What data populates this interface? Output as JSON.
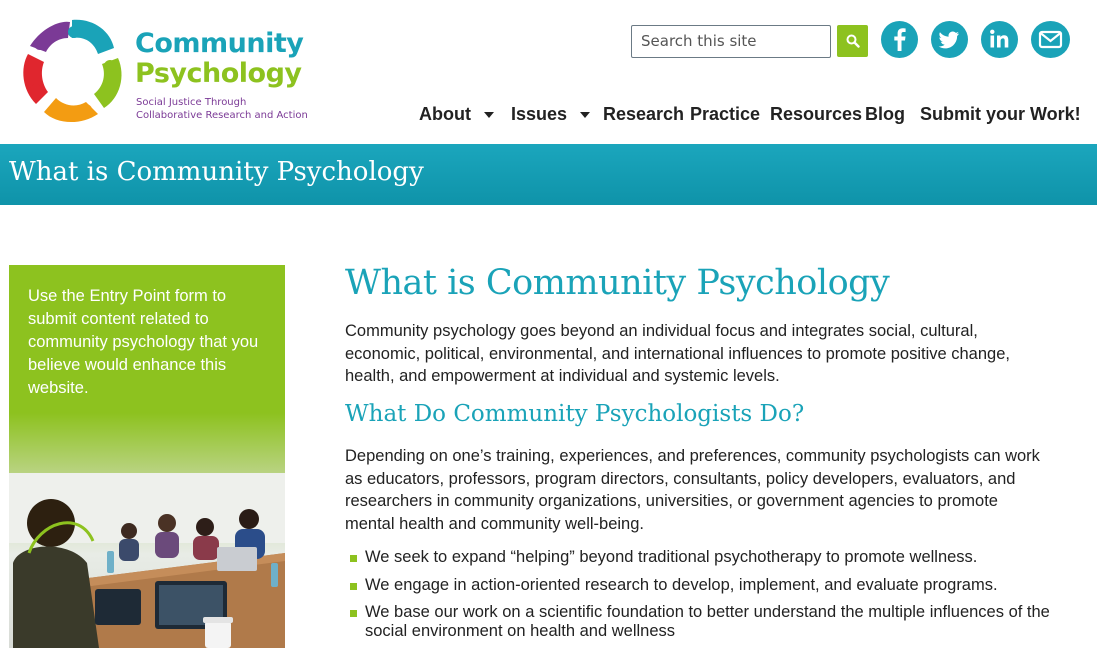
{
  "logo": {
    "word1": "Community",
    "word2": "Psychology",
    "tagline1": "Social Justice Through",
    "tagline2": "Collaborative Research and Action"
  },
  "search": {
    "placeholder": "Search this site",
    "button_icon": "search-icon"
  },
  "social": [
    {
      "icon": "facebook-icon"
    },
    {
      "icon": "twitter-icon"
    },
    {
      "icon": "linkedin-icon"
    },
    {
      "icon": "email-icon"
    }
  ],
  "nav": {
    "items": [
      {
        "label": "About",
        "has_dropdown": true
      },
      {
        "label": "Issues",
        "has_dropdown": true
      },
      {
        "label": "Research",
        "has_dropdown": false
      },
      {
        "label": "Practice",
        "has_dropdown": false
      },
      {
        "label": "Resources",
        "has_dropdown": false
      },
      {
        "label": "Blog",
        "has_dropdown": false
      },
      {
        "label": "Submit your Work!",
        "has_dropdown": false
      }
    ]
  },
  "banner": {
    "title": "What is Community Psychology"
  },
  "sidebar": {
    "text": "Use the Entry Point form to submit content related to community psychology that you believe would enhance this website."
  },
  "main": {
    "title": "What is Community Psychology",
    "intro": "Community psychology goes beyond an individual focus and integrates social, cultural, economic, political, environmental, and international influences to promote positive change, health, and empowerment at individual and systemic levels.",
    "subtitle": "What Do Community Psychologists Do?",
    "body": "Depending on one’s training, experiences, and preferences, community psychologists can work as educators, professors, program directors, consultants, policy developers, evaluators, and researchers in community organizations, universities, or government agencies to promote mental health and community well-being.",
    "bullets": [
      "We seek to expand “helping” beyond traditional psychotherapy to promote wellness.",
      "We engage in action-oriented research to develop, implement, and evaluate programs.",
      "We base our work on a scientific foundation to better understand the multiple influences of the social environment on health and wellness"
    ]
  },
  "colors": {
    "teal": "#1aa3b8",
    "green": "#8dc21f",
    "purple": "#7b3a96"
  }
}
